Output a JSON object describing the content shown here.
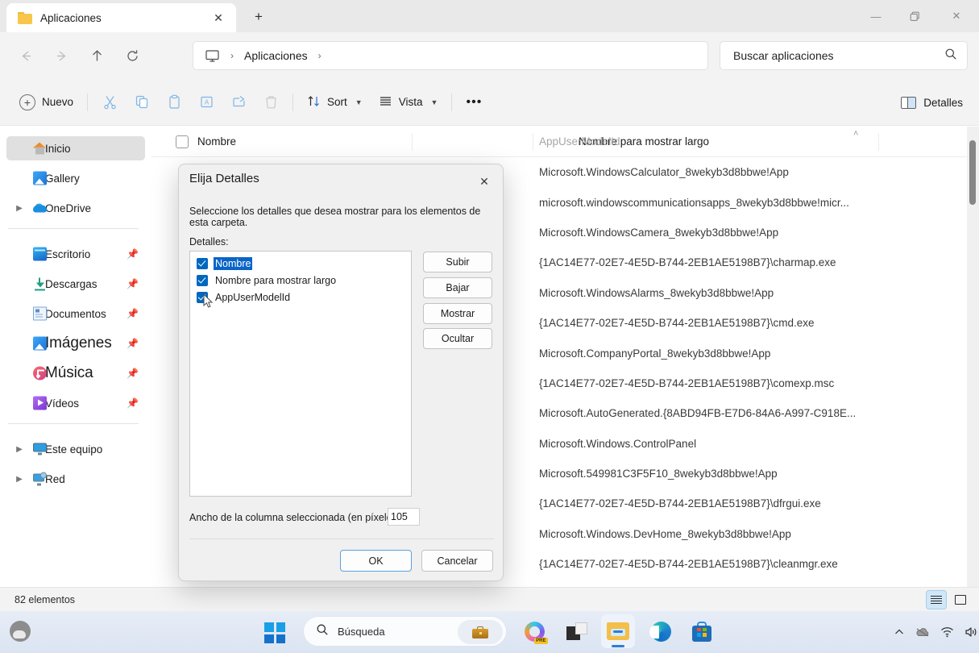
{
  "window": {
    "tab_title": "Aplicaciones",
    "new_tab_label": "+",
    "minimize": "—",
    "restore": "❐",
    "close": "✕"
  },
  "address": {
    "pc_crumb": "monitor-icon",
    "breadcrumb": "Aplicaciones",
    "sep": "›"
  },
  "search": {
    "placeholder": "Buscar aplicaciones",
    "value": "Buscar aplicaciones"
  },
  "toolbar": {
    "new_label": "Nuevo",
    "sort_label": "Sort",
    "view_label": "Vista",
    "more_label": "•••",
    "details_label": "Detalles",
    "icons": [
      "cut-icon",
      "copy-icon",
      "paste-icon",
      "rename-icon",
      "share-icon",
      "delete-icon"
    ]
  },
  "sidebar": {
    "items": [
      {
        "label": "Inicio",
        "icon": "home-icon",
        "active": true,
        "expander": false,
        "pinned": false,
        "big": false
      },
      {
        "label": "Gallery",
        "icon": "gallery-icon",
        "active": false,
        "expander": false,
        "pinned": false,
        "big": false
      },
      {
        "label": "OneDrive",
        "icon": "onedrive-icon",
        "active": false,
        "expander": true,
        "pinned": false,
        "big": false
      }
    ],
    "pinned": [
      {
        "label": "Escritorio",
        "icon": "desktop-icon",
        "pinned": true,
        "big": false
      },
      {
        "label": "Descargas",
        "icon": "downloads-icon",
        "pinned": true,
        "big": false
      },
      {
        "label": "Documentos",
        "icon": "documents-icon",
        "pinned": true,
        "big": false
      },
      {
        "label": "Imágenes",
        "icon": "pictures-icon",
        "pinned": true,
        "big": true
      },
      {
        "label": "Música",
        "icon": "music-icon",
        "pinned": true,
        "big": true
      },
      {
        "label": "Vídeos",
        "icon": "videos-icon",
        "pinned": true,
        "big": false
      }
    ],
    "devices": [
      {
        "label": "Este equipo",
        "icon": "this-pc-icon",
        "expander": true
      },
      {
        "label": "Red",
        "icon": "network-icon",
        "expander": true
      }
    ]
  },
  "columns": {
    "name": "Nombre",
    "display_name": "Nombre para mostrar largo",
    "aumid": "AppUserModelId",
    "sort_indicator": "˄"
  },
  "files": {
    "rows": [
      "Microsoft.WindowsCalculator_8wekyb3d8bbwe!App",
      "microsoft.windowscommunicationsapps_8wekyb3d8bbwe!micr...",
      "Microsoft.WindowsCamera_8wekyb3d8bbwe!App",
      "{1AC14E77-02E7-4E5D-B744-2EB1AE5198B7}\\charmap.exe",
      "Microsoft.WindowsAlarms_8wekyb3d8bbwe!App",
      "{1AC14E77-02E7-4E5D-B744-2EB1AE5198B7}\\cmd.exe",
      "Microsoft.CompanyPortal_8wekyb3d8bbwe!App",
      "{1AC14E77-02E7-4E5D-B744-2EB1AE5198B7}\\comexp.msc",
      "Microsoft.AutoGenerated.{8ABD94FB-E7D6-84A6-A997-C918E...",
      "Microsoft.Windows.ControlPanel",
      "Microsoft.549981C3F5F10_8wekyb3d8bbwe!App",
      "{1AC14E77-02E7-4E5D-B744-2EB1AE5198B7}\\dfrgui.exe",
      "Microsoft.Windows.DevHome_8wekyb3d8bbwe!App",
      "{1AC14E77-02E7-4E5D-B744-2EB1AE5198B7}\\cleanmgr.exe"
    ]
  },
  "status": {
    "items_count": "82 elementos"
  },
  "dialog": {
    "title": "Elija Detalles",
    "close": "✕",
    "description": "Seleccione los detalles que desea mostrar para los elementos de esta carpeta.",
    "details_label": "Detalles:",
    "list": [
      {
        "label": "Nombre",
        "checked": true,
        "selected": true
      },
      {
        "label": "Nombre para mostrar largo",
        "checked": true,
        "selected": false
      },
      {
        "label": "AppUserModelId",
        "checked": true,
        "selected": false
      }
    ],
    "buttons": {
      "up": "Subir",
      "down": "Bajar",
      "show": "Mostrar",
      "hide": "Ocultar",
      "ok": "OK",
      "cancel": "Cancelar"
    },
    "width_label": "Ancho de la columna seleccionada (en píxeles):",
    "width_value": "105"
  },
  "taskbar": {
    "search_placeholder": "Búsqueda",
    "icons": [
      "weather-icon",
      "start-icon",
      "search-icon",
      "briefcase-icon",
      "copilot-icon",
      "task-view-icon",
      "file-explorer-icon",
      "edge-icon",
      "store-icon"
    ],
    "tray": [
      "chevron-up-icon",
      "onedrive-tray-icon",
      "wifi-icon",
      "volume-icon",
      "battery-icon"
    ]
  },
  "colors": {
    "accent": "#0067c0",
    "selection": "#0a64c8",
    "window_bg": "#f3f3f3",
    "dialog_bg": "#f0f0f0"
  }
}
